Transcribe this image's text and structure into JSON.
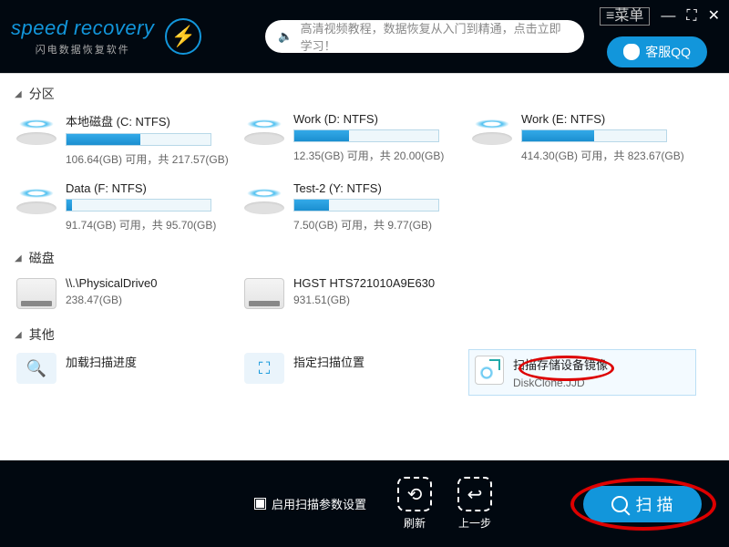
{
  "header": {
    "logo_main": "speed recovery",
    "logo_sub": "闪电数据恢复软件",
    "tutorial": "高清视频教程，数据恢复从入门到精通，点击立即学习！",
    "qq_label": "客服QQ",
    "menu_label": "≡菜单"
  },
  "sections": {
    "partitions": "分区",
    "disks": "磁盘",
    "other": "其他"
  },
  "partitions": [
    {
      "title": "本地磁盘 (C: NTFS)",
      "used_pct": 51,
      "sub": "106.64(GB) 可用，共 217.57(GB)"
    },
    {
      "title": "Work (D: NTFS)",
      "used_pct": 38,
      "sub": "12.35(GB) 可用，共 20.00(GB)"
    },
    {
      "title": "Work (E: NTFS)",
      "used_pct": 50,
      "sub": "414.30(GB) 可用，共 823.67(GB)"
    },
    {
      "title": "Data (F: NTFS)",
      "used_pct": 4,
      "sub": "91.74(GB) 可用，共 95.70(GB)"
    },
    {
      "title": "Test-2 (Y: NTFS)",
      "used_pct": 24,
      "sub": "7.50(GB) 可用，共 9.77(GB)"
    }
  ],
  "disks": [
    {
      "title": "\\\\.\\PhysicalDrive0",
      "sub": "238.47(GB)"
    },
    {
      "title": "HGST HTS721010A9E630",
      "sub": "931.51(GB)"
    }
  ],
  "other": {
    "load_progress": "加载扫描进度",
    "set_location": "指定扫描位置",
    "scan_image_title": "扫描存储设备镜像",
    "scan_image_file": "DiskClone.JJD"
  },
  "footer": {
    "param_label": "启用扫描参数设置",
    "refresh": "刷新",
    "back": "上一步",
    "scan": "扫 描"
  }
}
